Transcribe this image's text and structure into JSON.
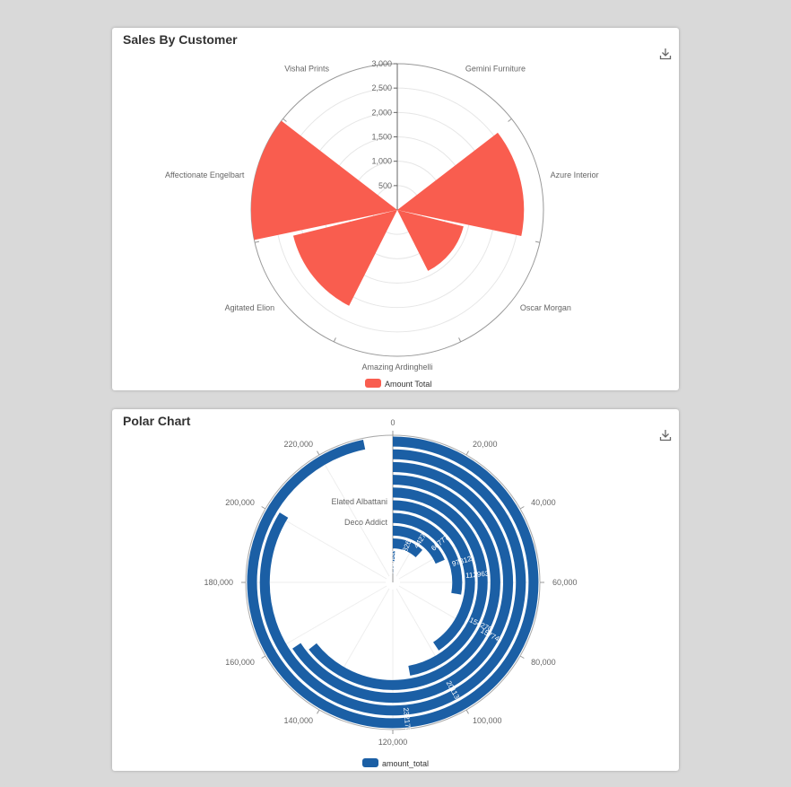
{
  "chart_data": [
    {
      "type": "polar-bar",
      "title": "Sales By Customer",
      "categories": [
        "Gemini Furniture",
        "Azure Interior",
        "Oscar Morgan",
        "Amazing Ardinghelli",
        "Agitated Elion",
        "Affectionate Engelbart",
        "Vishal Prints"
      ],
      "series": [
        {
          "name": "Amount Total",
          "values": [
            0,
            2600,
            1400,
            0,
            2200,
            3000,
            0
          ]
        }
      ],
      "radius_ticks": [
        "500",
        "1,000",
        "1,500",
        "2,000",
        "2,500",
        "3,000"
      ],
      "rmax": 3000,
      "color": "#f95d4f",
      "legend": "bottom"
    },
    {
      "type": "radial-bar",
      "title": "Polar Chart",
      "categories": [
        "Deco Addict",
        "Elated Albattani"
      ],
      "series": [
        {
          "name": "amount_total",
          "values": [
            729,
            2685,
            28265,
            44275,
            66777.9,
            97312.25,
            112963.65,
            154270.35,
            157745.8,
            201130.8,
            232173.1
          ]
        }
      ],
      "value_labels": [
        "729",
        "2685",
        "28265",
        "44275",
        "66777.9",
        "97312.25",
        "112963.65",
        "154270.35",
        "157745.8",
        "201130.8",
        "232173.1"
      ],
      "angle_ticks": [
        "0",
        "20,000",
        "40,000",
        "60,000",
        "80,000",
        "100,000",
        "120,000",
        "140,000",
        "160,000",
        "180,000",
        "200,000",
        "220,000"
      ],
      "amax": 240000,
      "color": "#1b5fa5",
      "legend": "bottom"
    }
  ]
}
